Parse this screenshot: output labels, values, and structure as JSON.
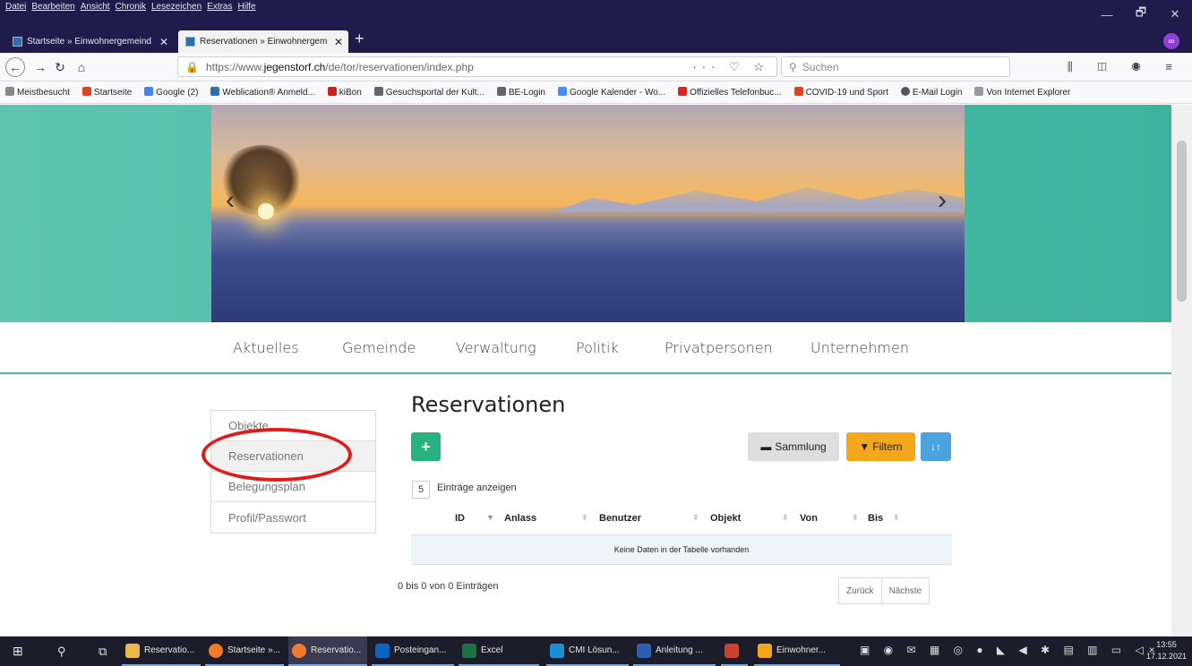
{
  "menu": [
    "Datei",
    "Bearbeiten",
    "Ansicht",
    "Chronik",
    "Lesezeichen",
    "Extras",
    "Hilfe"
  ],
  "tabs": [
    {
      "label": "Startseite » Einwohnergemeind",
      "close": "✕"
    },
    {
      "label": "Reservationen » Einwohnergem",
      "close": "✕"
    }
  ],
  "new_tab": "+",
  "window_controls": [
    "—",
    "🗗",
    "✕"
  ],
  "url_prefix": "https://www.",
  "url_domain": "jegenstorf.ch",
  "url_path": "/de/tor/reservationen/index.php",
  "url_icons": "··· ♡ ☆",
  "search_placeholder": "Suchen",
  "bookmarks": [
    "Meistbesucht",
    "Startseite",
    "Google (2)",
    "Weblication® Anmeld...",
    "kiBon",
    "Gesuchsportal der Kult...",
    "BE-Login",
    "Google Kalender - Wo...",
    "Offizielles Telefonbuc...",
    "COVID-19 und Sport",
    "E-Mail Login",
    "Von Internet Explorer"
  ],
  "main_nav": [
    "Aktuelles",
    "Gemeinde",
    "Verwaltung",
    "Politik",
    "Privatpersonen",
    "Unternehmen"
  ],
  "sidebar": [
    "Objekte",
    "Reservationen",
    "Belegungsplan",
    "Profil/Passwort"
  ],
  "page_title": "Reservationen",
  "buttons": {
    "add": "+",
    "sammlung": "Sammlung",
    "filter": "Filtern",
    "sort": "↓↑"
  },
  "length_value": "5",
  "length_label": "Einträge anzeigen",
  "columns": [
    "ID",
    "Anlass",
    "Benutzer",
    "Objekt",
    "Von",
    "Bis"
  ],
  "empty_text": "Keine Daten in der Tabelle vorhanden",
  "info_text": "0 bis 0 von 0 Einträgen",
  "pager": [
    "Zurück",
    "Nächste"
  ],
  "taskbar": [
    "Reservatio...",
    "Startseite »...",
    "Reservatio...",
    "Posteingan...",
    "Excel",
    "CMI Lösun...",
    "Anleitung ...",
    "",
    "Einwohner..."
  ],
  "clock_time": "13:55",
  "clock_date": "17.12.2021",
  "colors": {
    "accent": "#47b5a2",
    "add": "#27b27f",
    "filter": "#f4a61d",
    "sort": "#4aa3df",
    "highlight": "#e01b1b"
  }
}
